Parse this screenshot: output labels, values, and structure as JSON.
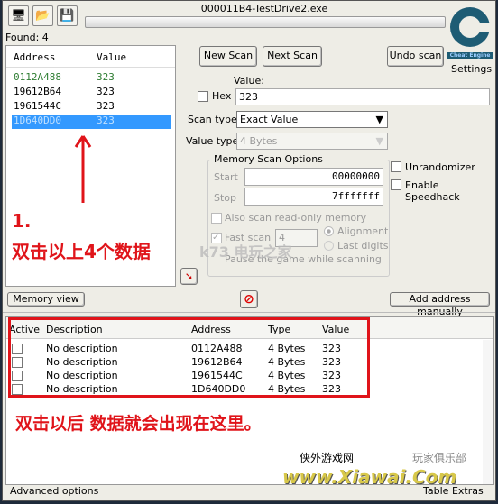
{
  "window": {
    "title": "000011B4-TestDrive2.exe"
  },
  "toolbar": {
    "icons": [
      "open-process-icon",
      "open-file-icon",
      "save-icon"
    ]
  },
  "logo": {
    "text": "Cheat Engine",
    "settings_label": "Settings"
  },
  "found": "Found: 4",
  "results": {
    "headers": [
      "Address",
      "Value"
    ],
    "rows": [
      {
        "address": "0112A488",
        "value": "323"
      },
      {
        "address": "19612B64",
        "value": "323"
      },
      {
        "address": "1961544C",
        "value": "323"
      },
      {
        "address": "1D640DD0",
        "value": "323"
      }
    ]
  },
  "scan": {
    "new_scan": "New Scan",
    "next_scan": "Next Scan",
    "undo_scan": "Undo scan",
    "value_label": "Value:",
    "hex_label": "Hex",
    "value": "323",
    "scan_type_label": "Scan type",
    "scan_type": "Exact Value",
    "value_type_label": "Value type",
    "value_type": "4 Bytes"
  },
  "memory_options": {
    "title": "Memory Scan Options",
    "start_label": "Start",
    "start": "00000000",
    "stop_label": "Stop",
    "stop": "7fffffff",
    "readonly": "Also scan read-only memory",
    "fast_scan": "Fast scan",
    "fast_value": "4",
    "alignment": "Alignment",
    "last_digits": "Last digits",
    "pause": "Pause the game while scanning"
  },
  "unrandomizer": "Unrandomizer",
  "speedhack": "Enable Speedhack",
  "memory_view": "Memory view",
  "add_manual": "Add address manually",
  "table": {
    "headers": [
      "Active",
      "Description",
      "Address",
      "Type",
      "Value"
    ],
    "rows": [
      {
        "description": "No description",
        "address": "0112A488",
        "type": "4 Bytes",
        "value": "323"
      },
      {
        "description": "No description",
        "address": "19612B64",
        "type": "4 Bytes",
        "value": "323"
      },
      {
        "description": "No description",
        "address": "1961544C",
        "type": "4 Bytes",
        "value": "323"
      },
      {
        "description": "No description",
        "address": "1D640DD0",
        "type": "4 Bytes",
        "value": "323"
      }
    ]
  },
  "annotations": {
    "step": "1.",
    "top": "双击以上4个数据",
    "bottom": "双击以后 数据就会出现在这里。"
  },
  "watermark": {
    "left": "侠外游戏网",
    "right": "玩家俱乐部",
    "url": "www.Xiawai.Com",
    "k73": "k73 电玩之家"
  },
  "status": {
    "advanced": "Advanced options",
    "extras": "Table Extras"
  },
  "colors": {
    "selection": "#3399ff",
    "annotation": "#e0141a",
    "first_row": "#2e7d32"
  }
}
